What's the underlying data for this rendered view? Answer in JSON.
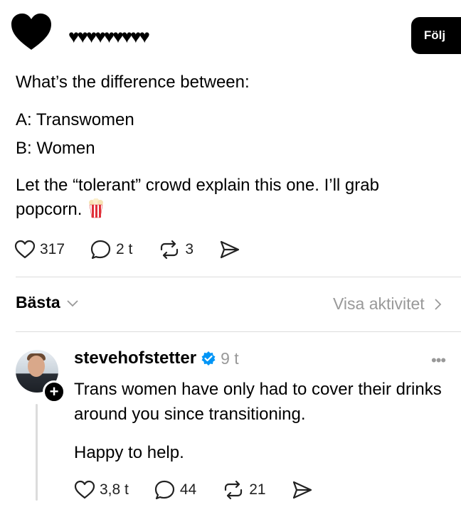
{
  "post": {
    "follow_label": "Följ",
    "lines": {
      "intro": "What’s the difference between:",
      "a": "A: Transwomen",
      "b": "B: Women",
      "body": "Let the “tolerant” crowd explain this one. I’ll grab popcorn."
    },
    "actions": {
      "likes": "317",
      "comments": "2 t",
      "reposts": "3"
    }
  },
  "sort": {
    "label": "Bästa",
    "activity_label": "Visa aktivitet"
  },
  "reply": {
    "username": "stevehofstetter",
    "time": "9 t",
    "text": "Trans women have only had to cover their drinks around you since transitioning.",
    "text2": "Happy to help.",
    "actions": {
      "likes": "3,8 t",
      "comments": "44",
      "reposts": "21"
    }
  },
  "icons": [
    "heart-icon",
    "comment-icon",
    "repost-icon",
    "share-icon",
    "chevron-down-icon",
    "chevron-right-icon",
    "verified-icon",
    "more-icon",
    "popcorn-icon",
    "plus-icon"
  ],
  "colors": {
    "follow_bg": "#000000",
    "muted": "#999999",
    "verified": "#0095f6",
    "divider": "#dcdcdc"
  }
}
